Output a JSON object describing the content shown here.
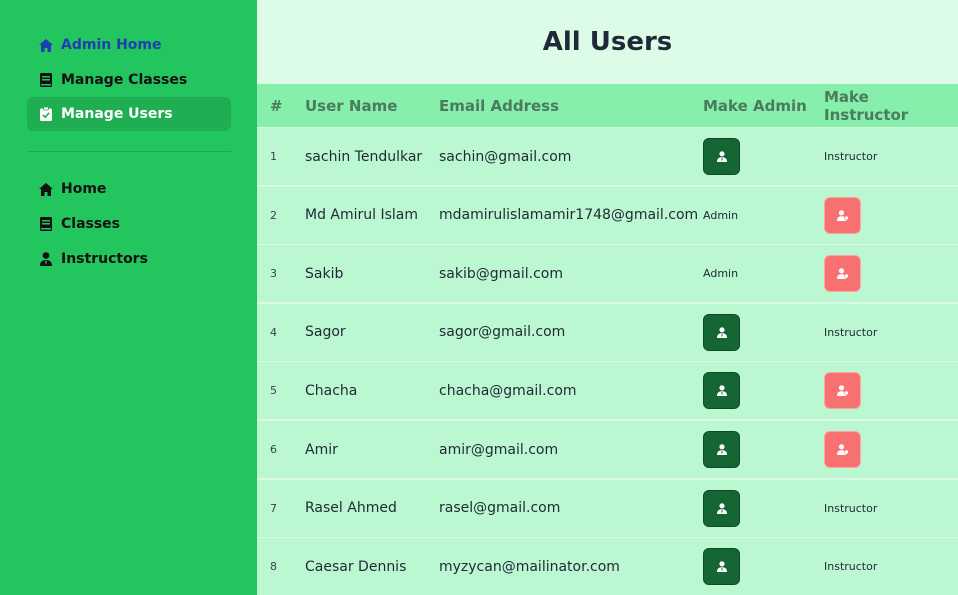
{
  "sidebar": {
    "items": [
      {
        "label": "Admin Home",
        "icon": "home-icon"
      },
      {
        "label": "Manage Classes",
        "icon": "book-icon"
      },
      {
        "label": "Manage Users",
        "icon": "clipboard-check-icon"
      },
      {
        "label": "Home",
        "icon": "home-icon"
      },
      {
        "label": "Classes",
        "icon": "book-icon"
      },
      {
        "label": "Instructors",
        "icon": "user-tie-icon"
      }
    ]
  },
  "main": {
    "title": "All Users",
    "columns": [
      "#",
      "User Name",
      "Email Address",
      "Make Admin",
      "Make Instructor"
    ],
    "rows": [
      {
        "num": "1",
        "name": "sachin Tendulkar",
        "email": "sachin@gmail.com",
        "admin": "button",
        "instructor": "Instructor"
      },
      {
        "num": "2",
        "name": "Md Amirul Islam",
        "email": "mdamirulislamamir1748@gmail.com",
        "admin": "Admin",
        "instructor": "button"
      },
      {
        "num": "3",
        "name": "Sakib",
        "email": "sakib@gmail.com",
        "admin": "Admin",
        "instructor": "button"
      },
      {
        "num": "4",
        "name": "Sagor",
        "email": "sagor@gmail.com",
        "admin": "button",
        "instructor": "Instructor"
      },
      {
        "num": "5",
        "name": "Chacha",
        "email": "chacha@gmail.com",
        "admin": "button",
        "instructor": "button"
      },
      {
        "num": "6",
        "name": "Amir",
        "email": "amir@gmail.com",
        "admin": "button",
        "instructor": "button"
      },
      {
        "num": "7",
        "name": "Rasel Ahmed",
        "email": "rasel@gmail.com",
        "admin": "button",
        "instructor": "Instructor"
      },
      {
        "num": "8",
        "name": "Caesar Dennis",
        "email": "myzycan@mailinator.com",
        "admin": "button",
        "instructor": "Instructor"
      }
    ]
  },
  "colors": {
    "sidebar": "#22c55e",
    "header_row": "#86efac",
    "row": "#bbf7d0",
    "admin_button": "#166534",
    "instructor_button": "#f87171"
  }
}
